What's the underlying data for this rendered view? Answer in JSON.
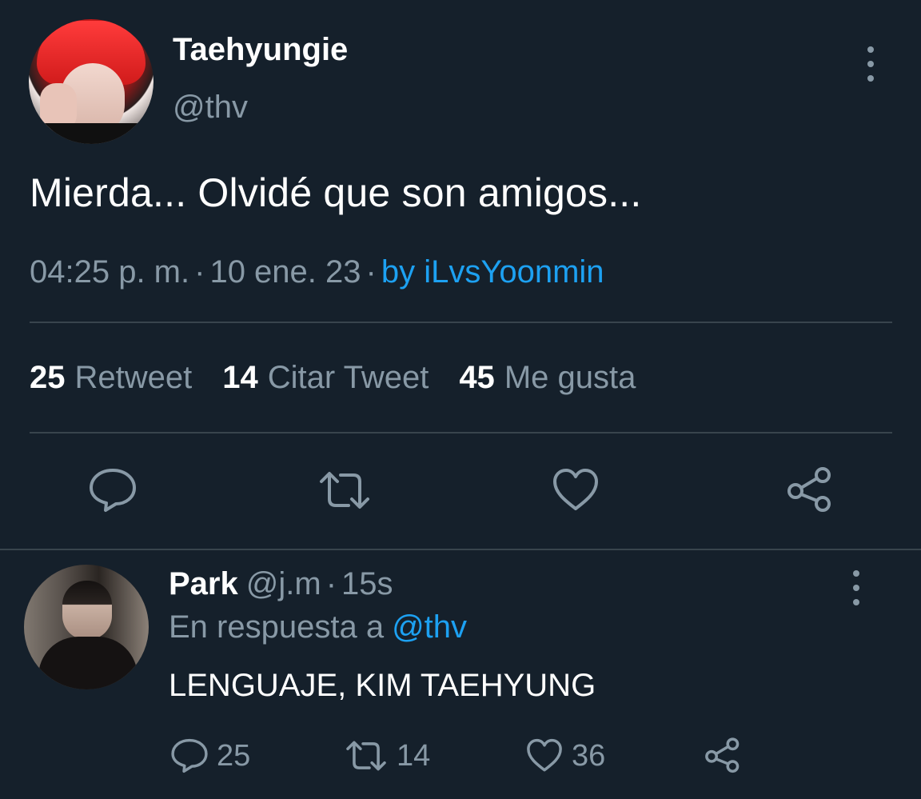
{
  "main_tweet": {
    "display_name": "Taehyungie",
    "handle": "@thv",
    "text": "Mierda... Olvidé que son amigos...",
    "time": "04:25 p. m.",
    "separator": "·",
    "date": "10 ene. 23",
    "via": "by iLvsYoonmin",
    "stats": {
      "retweets": {
        "count": "25",
        "label": "Retweet"
      },
      "quotes": {
        "count": "14",
        "label": "Citar Tweet"
      },
      "likes": {
        "count": "45",
        "label": "Me gusta"
      }
    },
    "actions": [
      "reply-icon",
      "retweet-icon",
      "heart-icon",
      "share-icon"
    ]
  },
  "reply": {
    "display_name": "Park",
    "handle": "@j.m",
    "separator": "·",
    "time_ago": "15s",
    "in_reply_prefix": "En respuesta a",
    "in_reply_mention": "@thv",
    "text": "LENGUAJE, KIM TAEHYUNG",
    "counts": {
      "replies": "25",
      "retweets": "14",
      "likes": "36"
    }
  },
  "colors": {
    "background": "#15202b",
    "secondary_text": "#8899a6",
    "accent": "#1da1f2",
    "divider": "#38444d"
  }
}
